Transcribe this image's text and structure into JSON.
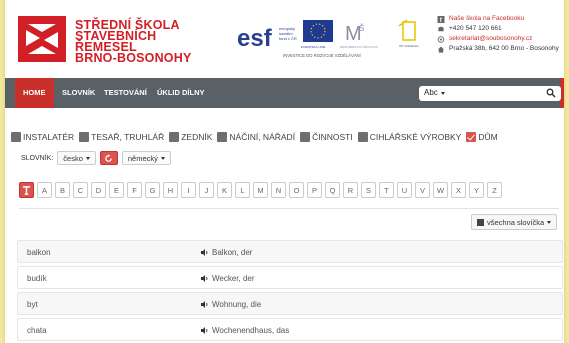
{
  "header": {
    "school_name_lines": [
      "STŘEDNÍ ŠKOLA",
      "STAVEBNÍCH",
      "ŘEMESEL",
      "BRNO-BOSONOHY"
    ],
    "contact": {
      "facebook": "Naše škola na Facebooku",
      "phone": "+420 547 120 661",
      "email": "sekretariat@soubosonohy.cz",
      "address": "Pražská 38b, 642 00 Brno - Bosonohy"
    },
    "sponsor_caption": "INVESTICE DO ROZVOJE VZDĚLÁVÁNÍ"
  },
  "nav": {
    "items": [
      {
        "label": "HOME",
        "active": true
      },
      {
        "label": "SLOVNÍK",
        "active": false
      },
      {
        "label": "TESTOVÁNÍ",
        "active": false
      },
      {
        "label": "ÚKLID DÍLNY",
        "active": false
      }
    ],
    "search_select": "Abc"
  },
  "categories": [
    {
      "label": "INSTALATÉR",
      "checked": false
    },
    {
      "label": "TESAŘ, TRUHLÁŘ",
      "checked": false
    },
    {
      "label": "ZEDNÍK",
      "checked": false
    },
    {
      "label": "NÁČINÍ, NÁŘADÍ",
      "checked": false
    },
    {
      "label": "ČINNOSTI",
      "checked": false
    },
    {
      "label": "CIHLÁŘSKÉ VÝROBKY",
      "checked": false
    },
    {
      "label": "DŮM",
      "checked": true
    }
  ],
  "dictionary": {
    "label": "SLOVNÍK:",
    "from": "česko",
    "to": "německý"
  },
  "letters": [
    "A",
    "B",
    "C",
    "D",
    "E",
    "F",
    "G",
    "H",
    "I",
    "J",
    "K",
    "L",
    "M",
    "N",
    "O",
    "P",
    "Q",
    "R",
    "S",
    "T",
    "U",
    "V",
    "W",
    "X",
    "Y",
    "Z"
  ],
  "all_words_label": "všechna slovíčka",
  "words": [
    {
      "cz": "balkon",
      "de": "Balkon, der"
    },
    {
      "cz": "budík",
      "de": "Wecker, der"
    },
    {
      "cz": "byt",
      "de": "Wohnung, die"
    },
    {
      "cz": "chata",
      "de": "Wochenendhaus, das"
    }
  ],
  "colors": {
    "brand_red": "#d21f26",
    "nav_bg": "#5a6166",
    "accent_red": "#d9534f",
    "outer_bg": "#f2e79a"
  }
}
